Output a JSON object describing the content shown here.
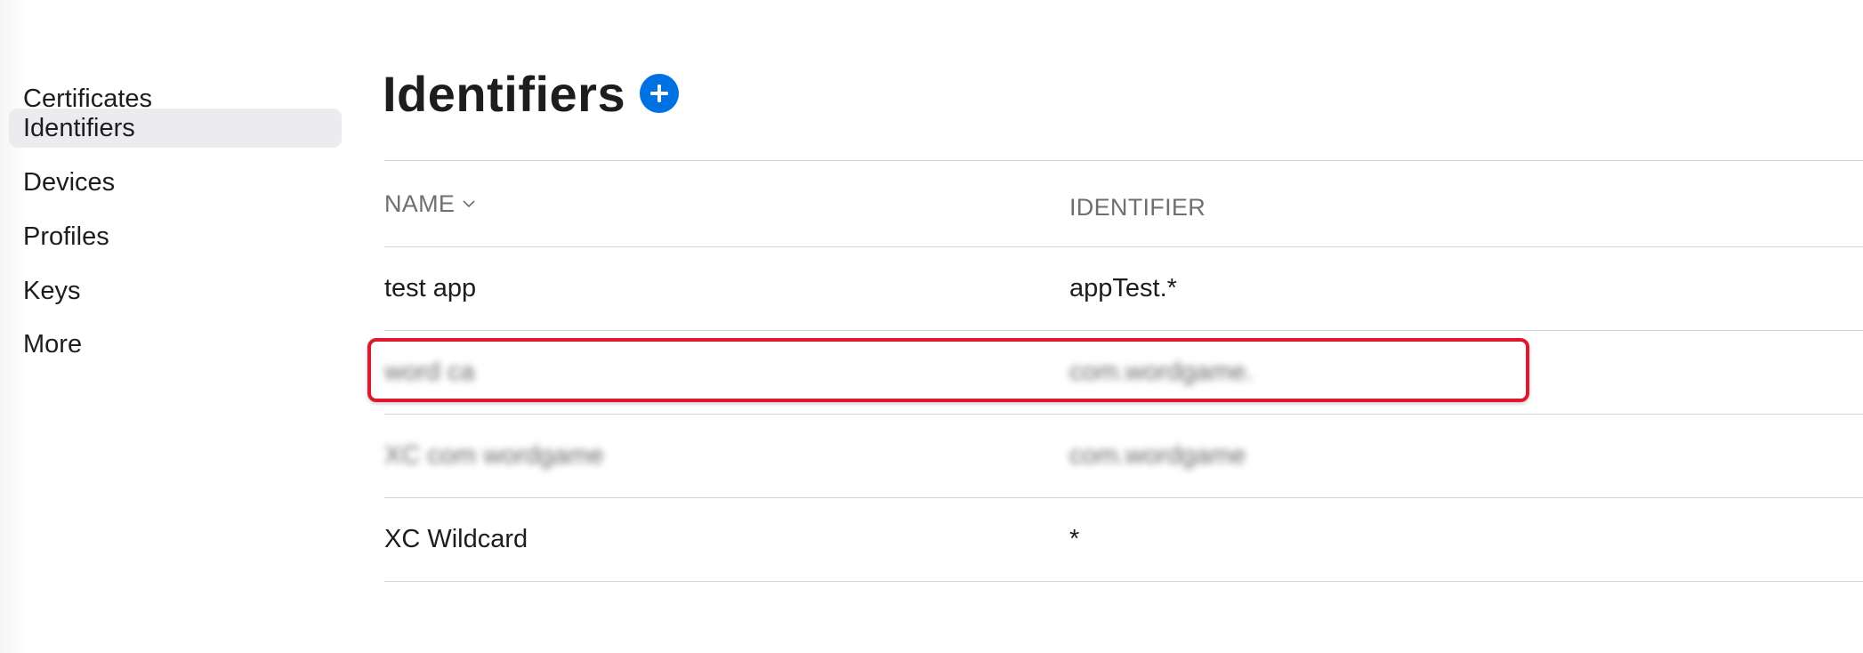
{
  "sidebar": {
    "items": [
      {
        "label": "Certificates",
        "active": false
      },
      {
        "label": "Identifiers",
        "active": true
      },
      {
        "label": "Devices",
        "active": false
      },
      {
        "label": "Profiles",
        "active": false
      },
      {
        "label": "Keys",
        "active": false
      },
      {
        "label": "More",
        "active": false
      }
    ]
  },
  "main": {
    "title": "Identifiers",
    "add_icon": "plus-circle-icon",
    "table": {
      "columns": [
        "NAME",
        "IDENTIFIER"
      ],
      "sort_icon": "chevron-down-icon",
      "rows": [
        {
          "name": "test app",
          "identifier": "appTest.*",
          "redacted": false
        },
        {
          "name": "word ca",
          "identifier": "com.wordgame.",
          "redacted": true
        },
        {
          "name": "XC com wordgame",
          "identifier": "com.wordgame",
          "redacted": true
        },
        {
          "name": "XC Wildcard",
          "identifier": "*",
          "redacted": false
        }
      ]
    }
  },
  "colors": {
    "accent": "#0071e3",
    "highlight": "#e0182d",
    "selected_bg": "#ececee",
    "divider": "#d2d2d7"
  }
}
